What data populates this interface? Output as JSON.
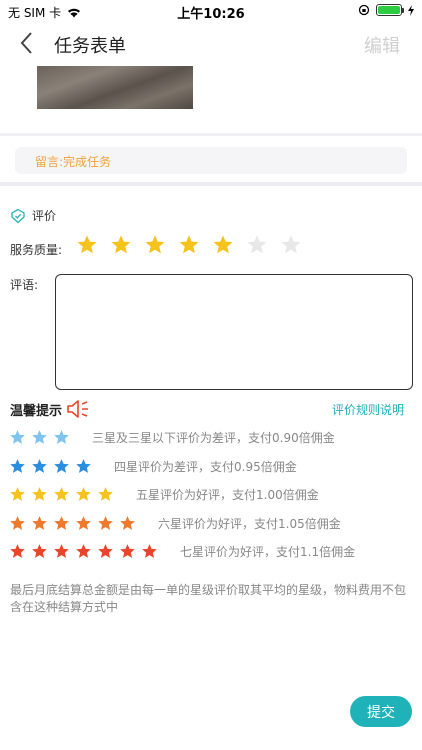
{
  "status_bar": {
    "carrier": "无 SIM 卡",
    "time": "上午10:26"
  },
  "nav": {
    "title": "任务表单",
    "edit_label": "编辑"
  },
  "remark": {
    "text": "留言:完成任务"
  },
  "evaluation": {
    "section_title": "评价",
    "quality_label": "服务质量:",
    "rating": 5,
    "max_rating": 7,
    "comment_label": "评语:",
    "comment_value": ""
  },
  "tips": {
    "title": "温馨提示",
    "rules_link": "评价规则说明",
    "tiers": [
      {
        "stars": 3,
        "color": "#7ec4ee",
        "text": "三星及三星以下评价为差评，支付0.90倍佣金"
      },
      {
        "stars": 4,
        "color": "#2a8fe0",
        "text": "四星评价为差评，支付0.95倍佣金"
      },
      {
        "stars": 5,
        "color": "#f6c21c",
        "text": "五星评价为好评，支付1.00倍佣金"
      },
      {
        "stars": 6,
        "color": "#f07a2c",
        "text": "六星评价为好评，支付1.05倍佣金"
      },
      {
        "stars": 7,
        "color": "#e8452a",
        "text": "七星评价为好评，支付1.1倍佣金"
      }
    ]
  },
  "footnote": "最后月底结算总金额是由每一单的星级评价取其平均的星级，物料费用不包含在这种结算方式中",
  "submit_label": "提交",
  "colors": {
    "accent": "#1fb3b9",
    "star_on": "#f6c21c",
    "star_off": "#e8e8e8",
    "remark_text": "#f0a23b"
  },
  "icons": [
    "back-chevron-icon",
    "evaluation-icon",
    "speaker-icon",
    "star-icon",
    "wifi-icon",
    "battery-icon"
  ]
}
